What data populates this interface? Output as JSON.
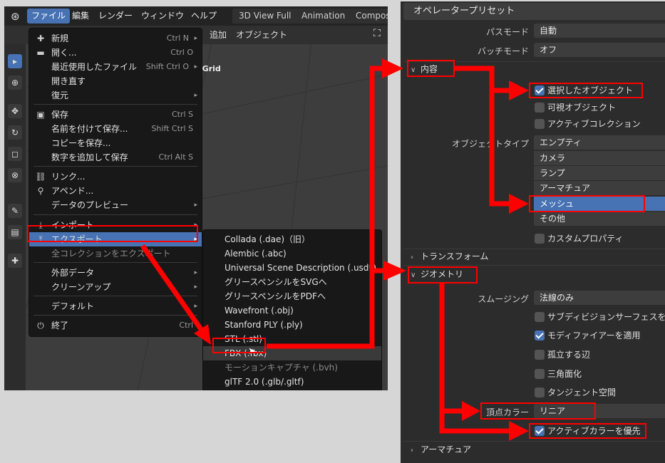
{
  "topbar": {
    "menus": [
      "ファイル",
      "編集",
      "レンダー",
      "ウィンドウ",
      "ヘルプ"
    ],
    "workspaces": [
      "3D View Full",
      "Animation",
      "Compos"
    ]
  },
  "viewport": {
    "header_items": [
      "追加",
      "オブジェクト"
    ],
    "label": "ョン | Grid"
  },
  "file_menu": {
    "items": [
      {
        "icon": "new-file-icon",
        "glyph": "✚",
        "label": "新規",
        "shortcut": "Ctrl N",
        "arrow": "▸"
      },
      {
        "icon": "folder-icon",
        "glyph": "▬",
        "label": "開く...",
        "shortcut": "Ctrl O"
      },
      {
        "icon": "",
        "glyph": "",
        "label": "最近使用したファイル",
        "shortcut": "Shift Ctrl O",
        "arrow": "▸"
      },
      {
        "icon": "",
        "glyph": "",
        "label": "開き直す",
        "shortcut": ""
      },
      {
        "icon": "",
        "glyph": "",
        "label": "復元",
        "shortcut": "",
        "arrow": "▸"
      },
      {
        "icon": "save-icon",
        "glyph": "▣",
        "label": "保存",
        "shortcut": "Ctrl S"
      },
      {
        "icon": "",
        "glyph": "",
        "label": "名前を付けて保存...",
        "shortcut": "Shift Ctrl S"
      },
      {
        "icon": "",
        "glyph": "",
        "label": "コピーを保存...",
        "shortcut": ""
      },
      {
        "icon": "",
        "glyph": "",
        "label": "数字を追加して保存",
        "shortcut": "Ctrl Alt S"
      },
      {
        "icon": "link-icon",
        "glyph": "⛓",
        "label": "リンク...",
        "shortcut": ""
      },
      {
        "icon": "append-icon",
        "glyph": "⚲",
        "label": "アペンド...",
        "shortcut": ""
      },
      {
        "icon": "",
        "glyph": "",
        "label": "データのプレビュー",
        "shortcut": "",
        "arrow": "▸"
      },
      {
        "icon": "import-icon",
        "glyph": "⤓",
        "label": "インポート",
        "shortcut": "",
        "arrow": "▸"
      },
      {
        "icon": "export-icon",
        "glyph": "⤒",
        "label": "エクスポート",
        "shortcut": "",
        "arrow": "▸"
      },
      {
        "icon": "",
        "glyph": "",
        "label": "全コレクションをエクスポート",
        "shortcut": ""
      },
      {
        "icon": "",
        "glyph": "",
        "label": "外部データ",
        "shortcut": "",
        "arrow": "▸"
      },
      {
        "icon": "",
        "glyph": "",
        "label": "クリーンアップ",
        "shortcut": "",
        "arrow": "▸"
      },
      {
        "icon": "",
        "glyph": "",
        "label": "デフォルト",
        "shortcut": "",
        "arrow": "▸"
      },
      {
        "icon": "power-icon",
        "glyph": "⏻",
        "label": "終了",
        "shortcut": "Ctrl"
      }
    ]
  },
  "export_submenu": {
    "items": [
      "Collada (.dae)（旧）",
      "Alembic (.abc)",
      "Universal Scene Description (.usd*)",
      "グリースペンシルをSVGへ",
      "グリースペンシルをPDFへ",
      "Wavefront (.obj)",
      "Stanford PLY (.ply)",
      "STL (.stl)",
      "FBX (.fbx)",
      "モーションキャプチャ (.bvh)",
      "glTF 2.0 (.glb/.gltf)"
    ]
  },
  "panel": {
    "title": "オペレータープリセット",
    "path_mode_label": "パスモード",
    "path_mode_value": "自動",
    "batch_mode_label": "バッチモード",
    "batch_mode_value": "オフ",
    "include_section": "内容",
    "cb_selected": "選択したオブジェクト",
    "cb_visible": "可視オブジェクト",
    "cb_active_collection": "アクティブコレクション",
    "object_type_label": "オブジェクトタイプ",
    "object_types": [
      "エンプティ",
      "カメラ",
      "ランプ",
      "アーマチュア",
      "メッシュ",
      "その他"
    ],
    "cb_custom_props": "カスタムプロパティ",
    "transform_section": "トランスフォーム",
    "geometry_section": "ジオメトリ",
    "smoothing_label": "スムージング",
    "smoothing_value": "法線のみ",
    "cb_subdivision": "サブディビジョンサーフェスを",
    "cb_apply_modifiers": "モディファイアーを適用",
    "cb_loose_edges": "孤立する辺",
    "cb_triangulate": "三角面化",
    "cb_tangent": "タンジェント空間",
    "vertex_color_label": "頂点カラー",
    "vertex_color_value": "リニア",
    "cb_prioritize_active": "アクティブカラーを優先",
    "armature_section": "アーマチュア"
  },
  "colors": {
    "accent": "#4772b3",
    "annotation": "#ff0000"
  }
}
